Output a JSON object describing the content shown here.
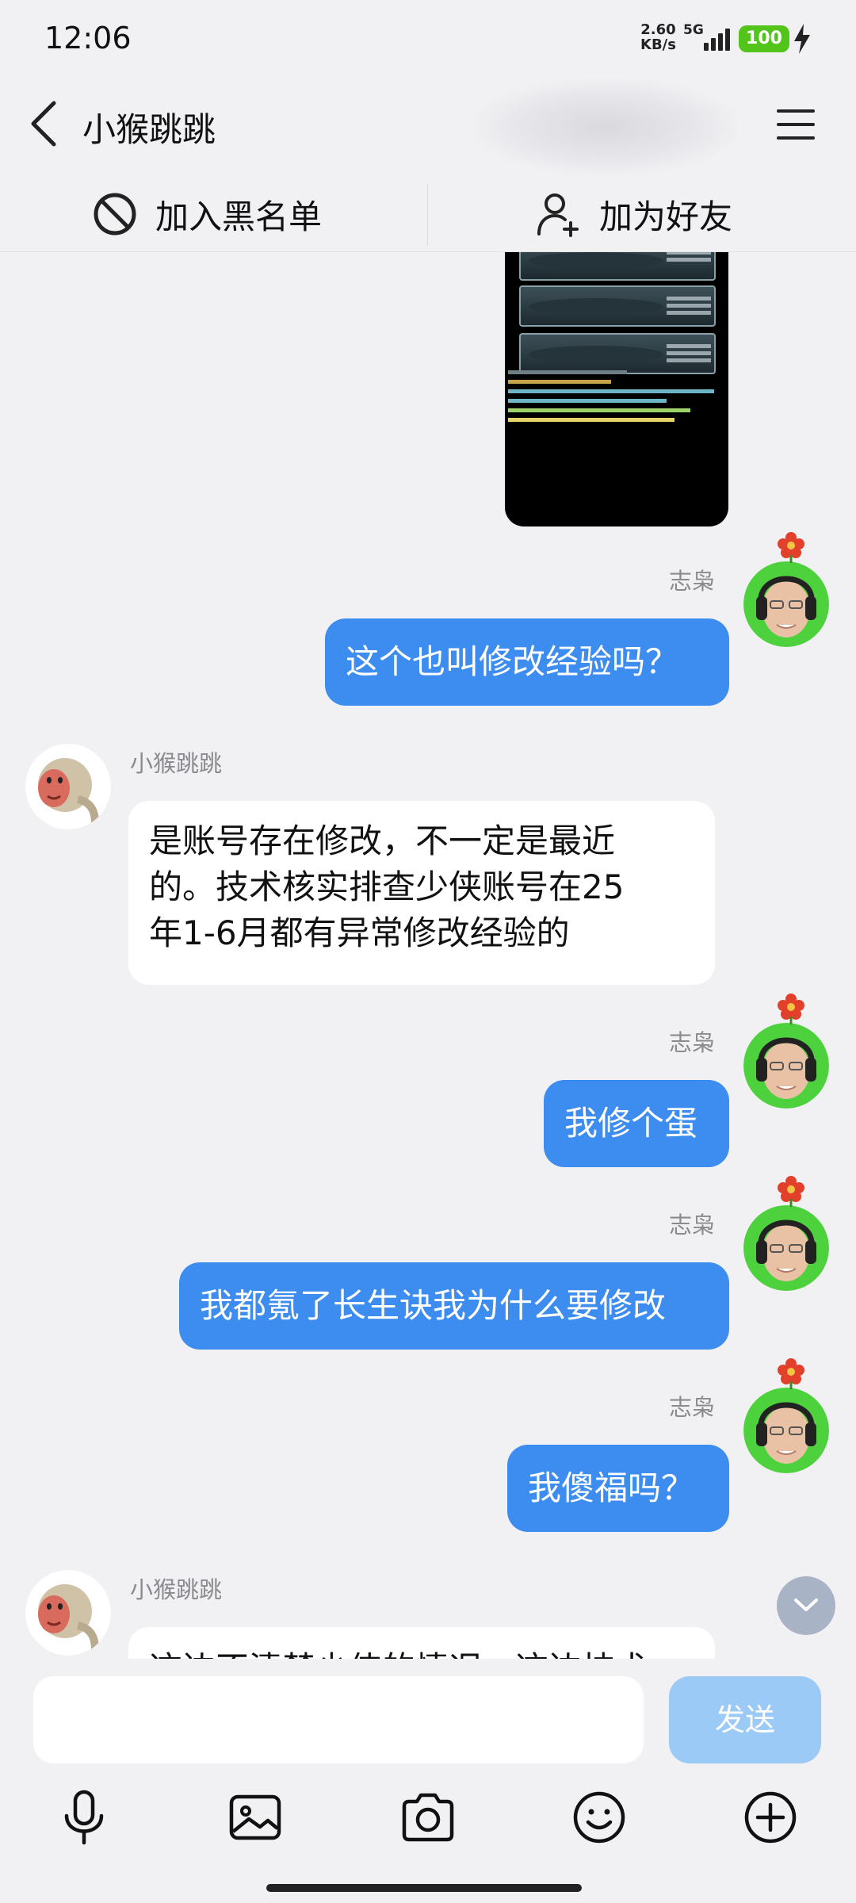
{
  "status_bar": {
    "time": "12:06",
    "net_speed_value": "2.60",
    "net_speed_unit": "KB/s",
    "network": "5G",
    "battery": "100"
  },
  "header": {
    "title": "小猴跳跳",
    "back_icon": "chevron-left-icon",
    "menu_icon": "hamburger-menu-icon"
  },
  "actions": {
    "blacklist": "加入黑名单",
    "add_friend": "加为好友"
  },
  "messages": [
    {
      "sender": "志枭",
      "text": "这个也叫修改经验吗？",
      "direction": "out"
    },
    {
      "sender": "小猴跳跳",
      "line1": "是账号存在修改，不一定是最近",
      "line2": "的。技术核实排查少侠账号在25",
      "line3": "年1-6月都有异常修改经验的",
      "direction": "in"
    },
    {
      "sender": "志枭",
      "text": "我修个蛋",
      "direction": "out"
    },
    {
      "sender": "志枭",
      "text": "我都氪了长生诀我为什么要修改",
      "direction": "out"
    },
    {
      "sender": "志枭",
      "text": "我傻福吗？",
      "direction": "out"
    },
    {
      "sender": "小猴跳跳",
      "text": "这边不清楚少侠的情况，这边技术",
      "direction": "in"
    }
  ],
  "input": {
    "placeholder": "",
    "send": "发送"
  },
  "toolbar_icons": [
    "microphone-icon",
    "image-icon",
    "camera-icon",
    "emoji-icon",
    "plus-icon"
  ],
  "colors": {
    "outgoing_bubble": "#3d8cf0",
    "incoming_bubble": "#ffffff",
    "background": "#f1f1f4",
    "send_button": "#9ccaf7",
    "battery": "#52c41a"
  }
}
